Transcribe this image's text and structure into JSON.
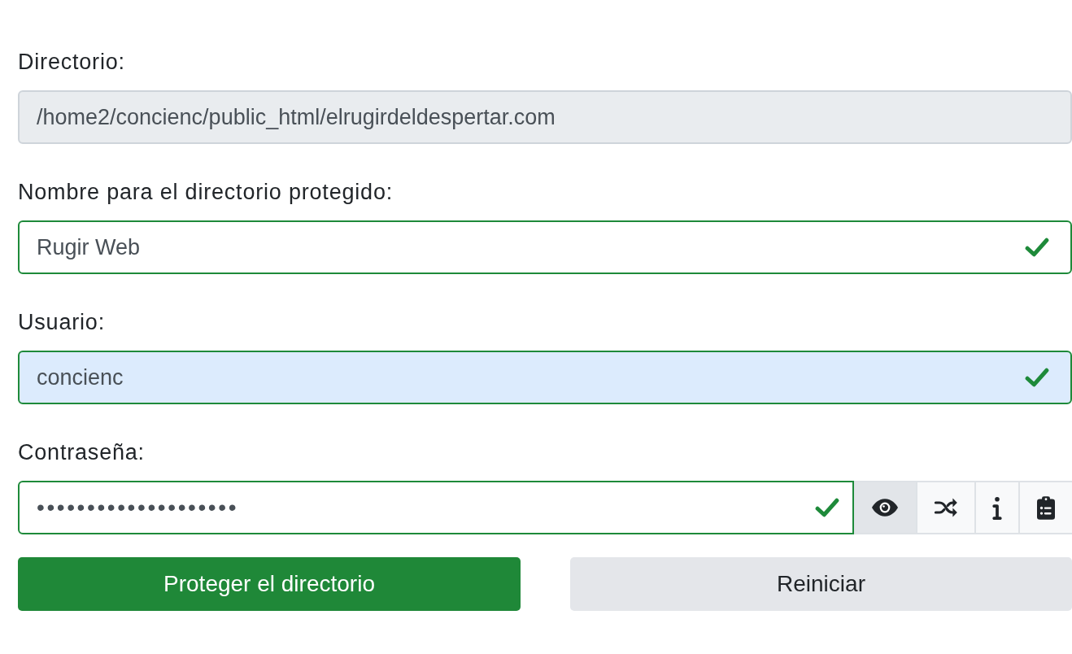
{
  "fields": [
    {
      "kind": "readonly",
      "label": "Directorio:",
      "value": "/home2/concienc/public_html/elrugirdeldespertar.com",
      "valid": false,
      "autofilled": false
    },
    {
      "kind": "text",
      "label": "Nombre para el directorio protegido:",
      "value": "Rugir Web",
      "valid": true,
      "autofilled": false
    },
    {
      "kind": "text",
      "label": "Usuario:",
      "value": "concienc",
      "valid": true,
      "autofilled": true
    },
    {
      "kind": "password",
      "label": "Contraseña:",
      "value": "••••••••••••••••••••",
      "valid": true,
      "autofilled": false,
      "tools": [
        {
          "kind": "eye",
          "pressed": true
        },
        {
          "kind": "shuffle",
          "pressed": false
        },
        {
          "kind": "info",
          "pressed": false
        },
        {
          "kind": "clipboard",
          "pressed": false
        }
      ]
    }
  ],
  "actions": [
    {
      "kind": "primary",
      "label": "Proteger el directorio"
    },
    {
      "kind": "secondary",
      "label": "Reiniciar"
    }
  ]
}
